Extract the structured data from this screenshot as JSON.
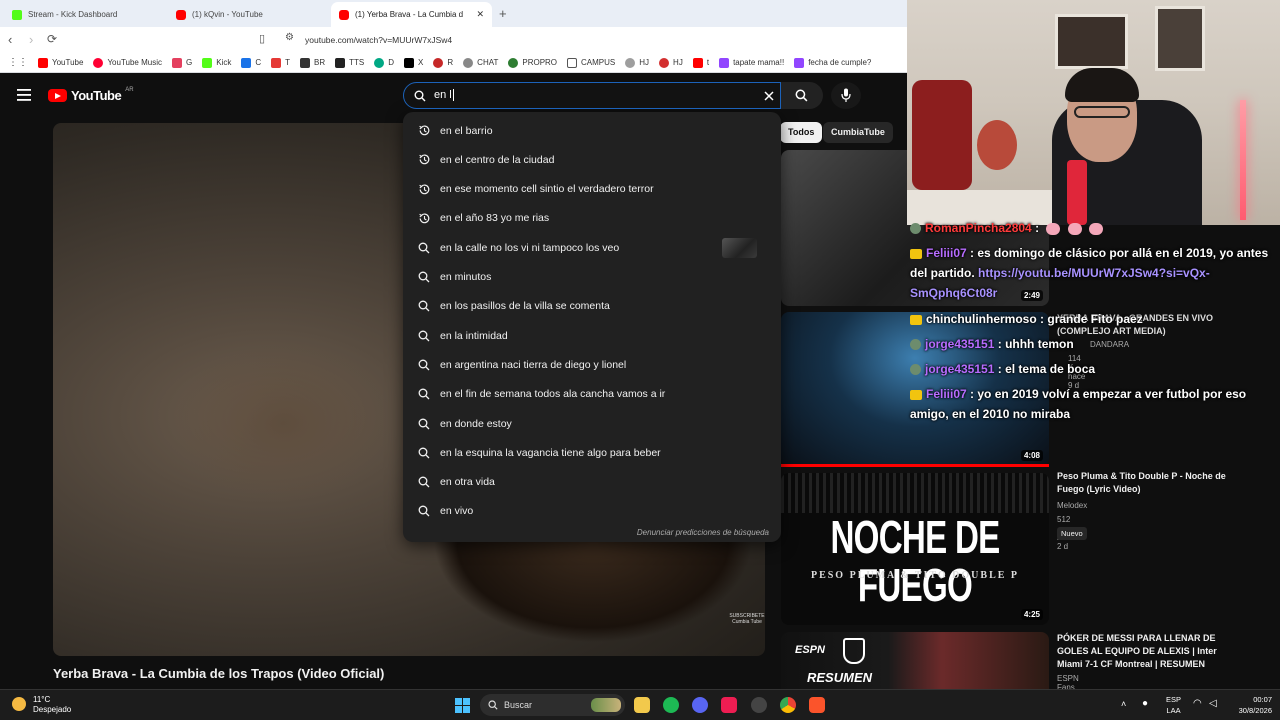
{
  "browser": {
    "tabs": [
      {
        "label": "Stream - Kick Dashboard",
        "fav_color": "#53fc18"
      },
      {
        "label": "(1) kQvin - YouTube",
        "fav_color": "#ff0000"
      },
      {
        "label": "(1) Yerba Brava - La Cumbia d",
        "fav_color": "#ff0000"
      }
    ],
    "new_tab": "+",
    "close": "✕",
    "url": "youtube.com/watch?v=MUUrW7xJSw4",
    "bookmarks": [
      "YouTube",
      "YouTube Music",
      "G",
      "Kick",
      "C",
      "T",
      "BR",
      "TTS",
      "D",
      "X",
      "R",
      "CHAT",
      "PROPRO",
      "CAMPUS",
      "HJ",
      "HJ",
      "t",
      "tapate mama!!",
      "fecha de cumple?"
    ]
  },
  "youtube": {
    "logo_text": "YouTube",
    "country": "AR",
    "search_query": "en l",
    "suggestions": [
      {
        "text": "en el barrio",
        "icon": "history-icon"
      },
      {
        "text": "en el centro de la ciudad",
        "icon": "history-icon"
      },
      {
        "text": "en ese momento cell sintio el verdadero terror",
        "icon": "history-icon"
      },
      {
        "text": "en el año 83 yo me rias",
        "icon": "history-icon"
      },
      {
        "text": "en la calle no los vi ni tampoco los veo",
        "icon": "search-icon"
      },
      {
        "text": "en minutos",
        "icon": "search-icon"
      },
      {
        "text": "en los pasillos de la villa se comenta",
        "icon": "search-icon"
      },
      {
        "text": "en la intimidad",
        "icon": "search-icon"
      },
      {
        "text": "en argentina naci tierra de diego y lionel",
        "icon": "search-icon"
      },
      {
        "text": "en el fin de semana todos ala cancha vamos a ir",
        "icon": "search-icon"
      },
      {
        "text": "en donde estoy",
        "icon": "search-icon"
      },
      {
        "text": "en la esquina la vagancia tiene algo para beber",
        "icon": "search-icon"
      },
      {
        "text": "en otra vida",
        "icon": "search-icon"
      },
      {
        "text": "en vivo",
        "icon": "search-icon"
      }
    ],
    "report_text": "Denunciar predicciones de búsqueda",
    "video_title": "Yerba Brava - La Cumbia de los Trapos (Video Oficial)",
    "watermark": "SUBSCRIBETE Cumbia Tube",
    "chips": [
      "Todos",
      "CumbiaTube"
    ],
    "related": [
      {
        "duration": "2:49"
      },
      {
        "title": "VIVO (COMPLEJO ART MEDIA)",
        "title_prefix": "YERBA BRAVA - GRANDES EN",
        "channel": "DANDARA",
        "meta": "114 K · hace 9 d",
        "duration": "4:08"
      },
      {
        "title": "Peso Pluma & Tito Double P - Noche de Fuego (Lyric Video)",
        "channel": "Melodex",
        "meta": "512 · hace 2 d",
        "badge": "Nuevo",
        "duration": "4:25",
        "thumb_text": "NOCHE DE FUEGO",
        "thumb_sub": "PESO PLUMA & TITO DOUBLE P"
      },
      {
        "title": "PÓKER DE MESSI PARA LLENAR DE GOLES AL EQUIPO DE ALEXIS | Inter Miami 7-1 CF Montreal | RESUMEN",
        "channel": "ESPN Fans",
        "thumb_text": "RESUMEN",
        "thumb_logo": "ESPN"
      }
    ]
  },
  "chat": [
    {
      "user": "RomanPincha2804",
      "user_color": "#ff3b3b",
      "text": ":",
      "emotes": true
    },
    {
      "user": "Feliii07",
      "user_color": "#b76cff",
      "text": ": es domingo de clásico por allá en el 2019, yo antes del partido.",
      "link": "https://youtu.be/MUUrW7xJSw4?si=vQx-SmQphq6Ct08r",
      "badge": "crown"
    },
    {
      "user": "chinchulinhermoso",
      "user_color": "#ffffff",
      "text": ": grande Fito paez",
      "badge": "crown"
    },
    {
      "user": "jorge435151",
      "user_color": "#b76cff",
      "text": ": uhhh temon",
      "badge": "avatar"
    },
    {
      "user": "jorge435151",
      "user_color": "#b76cff",
      "text": ": el tema de boca",
      "badge": "avatar"
    },
    {
      "user": "Feliii07",
      "user_color": "#b76cff",
      "text": ": yo en 2019 volví a empezar a ver futbol por eso amigo, en el 2010 no miraba",
      "badge": "crown"
    }
  ],
  "taskbar": {
    "temp": "11°C",
    "weather": "Despejado",
    "search_label": "Buscar",
    "lang_top": "ESP",
    "lang_bottom": "LAA",
    "time": "00:07",
    "date": "30/8/2026"
  }
}
